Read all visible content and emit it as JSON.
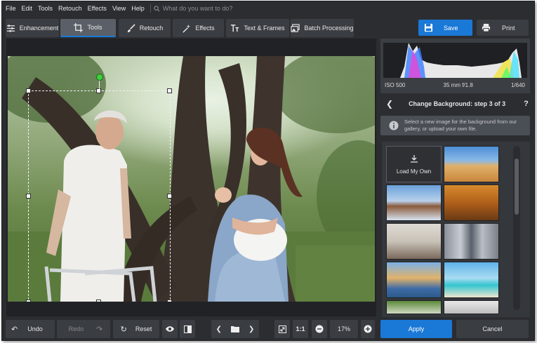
{
  "menu": {
    "items": [
      "File",
      "Edit",
      "Tools",
      "Retouch",
      "Effects",
      "View",
      "Help"
    ],
    "search_placeholder": "What do you want to do?"
  },
  "tabs": [
    {
      "label": "Enhancement",
      "icon": "sliders-icon"
    },
    {
      "label": "Tools",
      "icon": "crop-icon",
      "active": true
    },
    {
      "label": "Retouch",
      "icon": "brush-icon"
    },
    {
      "label": "Effects",
      "icon": "magic-wand-icon"
    },
    {
      "label": "Text & Frames",
      "icon": "text-icon"
    },
    {
      "label": "Batch Processing",
      "icon": "images-icon"
    }
  ],
  "actions": {
    "save": "Save",
    "print": "Print"
  },
  "histogram": {
    "iso": "ISO 500",
    "lens": "35 mm f/1.8",
    "shutter": "1/640"
  },
  "panel": {
    "step_title": "Change Background: step 3 of 3",
    "help": "?",
    "info": "Select a new image for the background from our gallery, or upload your own file.",
    "load_own": "Load My Own"
  },
  "bottom": {
    "undo": "Undo",
    "redo": "Redo",
    "reset": "Reset",
    "ratio": "1:1",
    "zoom": "17%",
    "apply": "Apply",
    "cancel": "Cancel"
  },
  "colors": {
    "accent": "#1a78d6",
    "bg": "#2b2d31",
    "panel": "#3a3d42",
    "selection_handle_rotate": "#3bd23b"
  }
}
